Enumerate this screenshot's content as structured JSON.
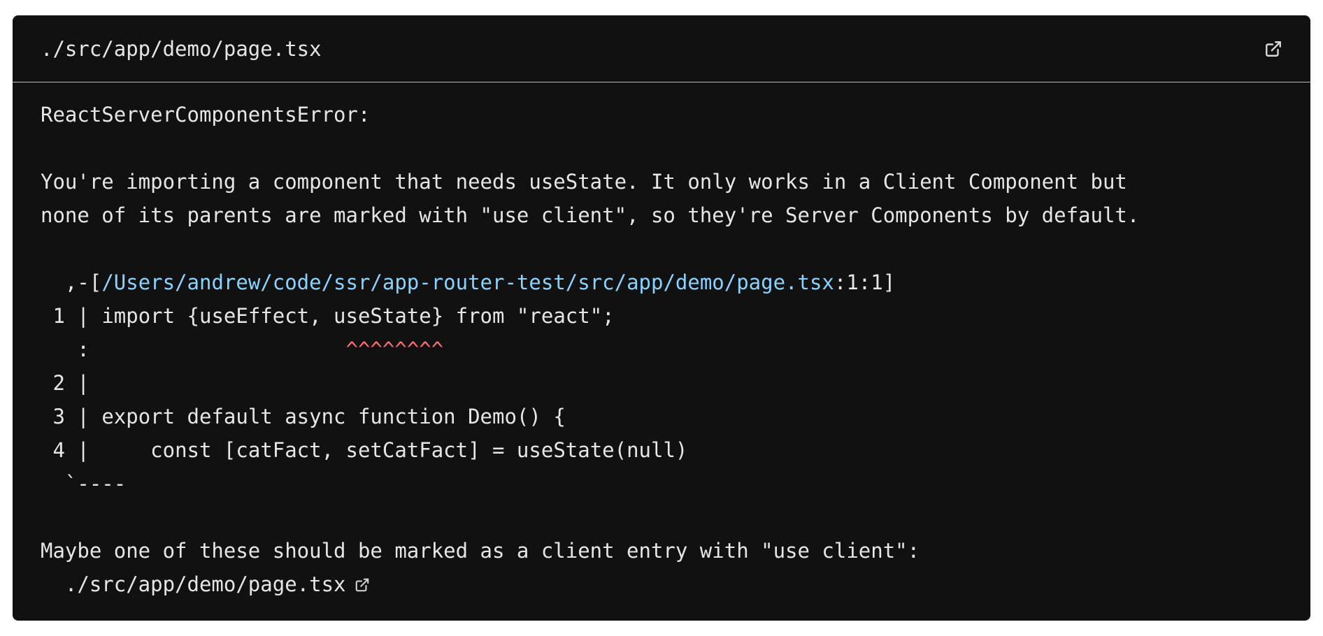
{
  "header": {
    "file_path": "./src/app/demo/page.tsx",
    "open_icon": "external-link-icon"
  },
  "error": {
    "title": "ReactServerComponentsError:",
    "message_line1": "You're importing a component that needs useState. It only works in a Client Component but",
    "message_line2": "none of its parents are marked with \"use client\", so they're Server Components by default."
  },
  "snippet": {
    "frame_open_prefix": "  ,-[",
    "frame_path": "/Users/andrew/code/ssr/app-router-test/src/app/demo/page.tsx",
    "frame_open_suffix": ":1:1]",
    "lines": [
      {
        "gutter": " 1 | ",
        "code": "import {useEffect, useState} from \"react\";"
      },
      {
        "gutter": "   : ",
        "code": "",
        "marker_pad": "                    ",
        "marker": "^^^^^^^^"
      },
      {
        "gutter": " 2 | ",
        "code": ""
      },
      {
        "gutter": " 3 | ",
        "code": "export default async function Demo() {"
      },
      {
        "gutter": " 4 | ",
        "code": "    const [catFact, setCatFact] = useState(null)"
      }
    ],
    "frame_close": "  `----"
  },
  "suggestion": {
    "text": "Maybe one of these should be marked as a client entry with \"use client\":",
    "file": "  ./src/app/demo/page.tsx",
    "open_icon": "external-link-icon"
  }
}
